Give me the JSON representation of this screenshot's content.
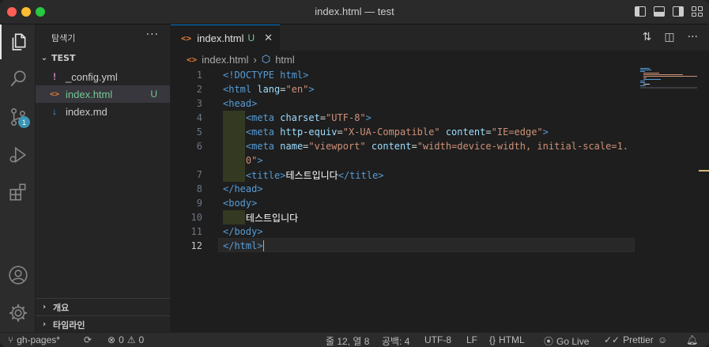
{
  "window": {
    "title": "index.html — test"
  },
  "activity_bar": {
    "scm_badge": "1"
  },
  "sidebar": {
    "header": "탐색기",
    "more": "···",
    "section": "TEST",
    "files": [
      {
        "icon": "!",
        "name": "_config.yml",
        "status": ""
      },
      {
        "icon": "<>",
        "name": "index.html",
        "status": "U"
      },
      {
        "icon": "↓",
        "name": "index.md",
        "status": ""
      }
    ],
    "outline_label": "개요",
    "timeline_label": "타임라인"
  },
  "editor": {
    "tab": {
      "name": "index.html",
      "status": "U"
    },
    "breadcrumb": {
      "file": "index.html",
      "symbol": "html"
    },
    "line_numbers": [
      "1",
      "2",
      "3",
      "4",
      "5",
      "6",
      "",
      "7",
      "8",
      "9",
      "10",
      "11",
      "12"
    ],
    "lines": [
      "<!DOCTYPE html>",
      "<html lang=\"en\">",
      "<head>",
      "<meta charset=\"UTF-8\">",
      "<meta http-equiv=\"X-UA-Compatible\" content=\"IE=edge\">",
      "<meta name=\"viewport\" content=\"width=device-width, initial-scale=1.",
      "0\">",
      "<title>테스트입니다</title>",
      "</head>",
      "<body>",
      "테스트입니다",
      "</body>",
      "</html>"
    ]
  },
  "statusbar": {
    "branch": "gh-pages*",
    "errors": "0",
    "warnings": "0",
    "position": "줄 12, 열 8",
    "spaces": "공백: 4",
    "encoding": "UTF-8",
    "eol": "LF",
    "language": "HTML",
    "golive": "Go Live",
    "prettier": "Prettier"
  },
  "colors": {
    "accent": "#0078d4",
    "untracked": "#73c991",
    "tag": "#569cd6",
    "attr": "#9cdcfe",
    "string": "#ce9178"
  }
}
